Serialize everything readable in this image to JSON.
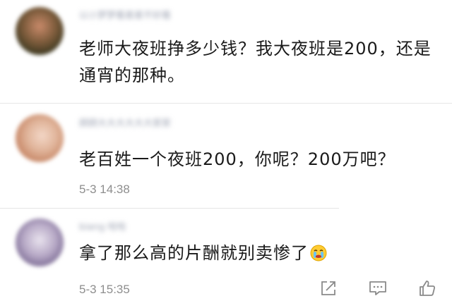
{
  "comments": [
    {
      "username": "以小梦梦看差差不好看",
      "text": "老师大夜班挣多少钱？我大夜班是200，还是通宵的那种。",
      "timestamp": ""
    },
    {
      "username": "顾顾大大大大大大家家",
      "text": "老百姓一个夜班200，你呢？200万吧？",
      "timestamp": "5-3 14:38"
    },
    {
      "username": "biang 哈哈",
      "text": "拿了那么高的片酬就别卖惨了",
      "timestamp": "5-3 15:35"
    }
  ],
  "icons": {
    "emoji": "crying-emoji-icon",
    "share": "share-edit-icon",
    "reply": "comment-icon",
    "like": "thumbs-up-icon"
  },
  "colors": {
    "text": "#1a1a1a",
    "meta": "#8e8e8e",
    "divider": "#e6e6e6"
  }
}
